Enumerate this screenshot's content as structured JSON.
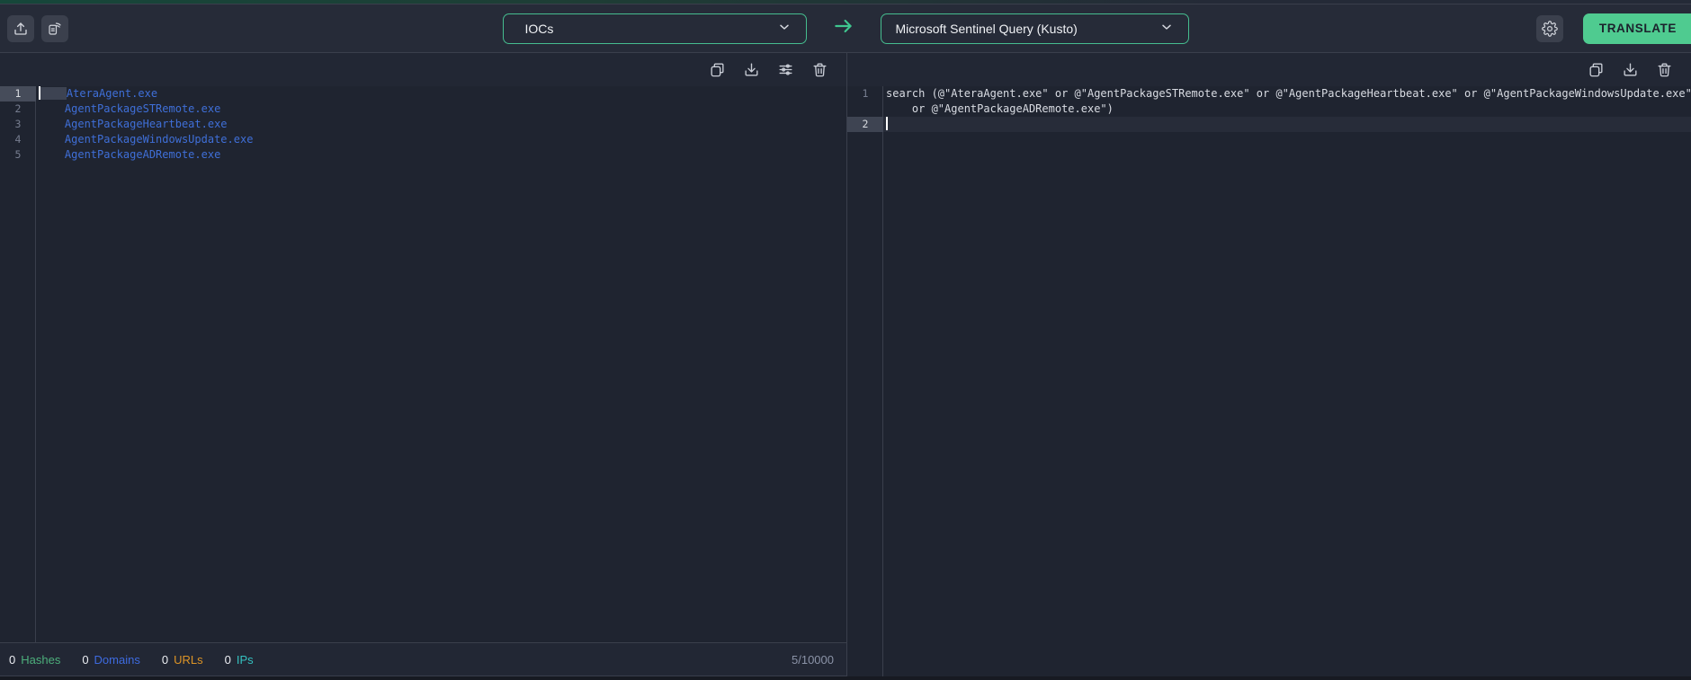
{
  "header": {
    "source_select": {
      "value": "IOCs"
    },
    "target_select": {
      "value": "Microsoft Sentinel Query (Kusto)"
    },
    "translate_label": "TRANSLATE"
  },
  "icons": {
    "upload": "tray-with-up-arrow",
    "bulk-samples": "fanned-document-stack",
    "copy": "two-overlapping-rectangles",
    "download": "tray-with-down-arrow",
    "ioc-settings": "horizontal-sliders",
    "delete": "trash-can",
    "settings": "gear-cog",
    "chevron-down": "⌄",
    "arrow-right": "→"
  },
  "source_editor": {
    "indent": "    ",
    "active_line": 1,
    "lines": [
      "AteraAgent.exe",
      "AgentPackageSTRemote.exe",
      "AgentPackageHeartbeat.exe",
      "AgentPackageWindowsUpdate.exe",
      "AgentPackageADRemote.exe"
    ]
  },
  "target_editor": {
    "active_line": 2,
    "rows": [
      {
        "number": "1",
        "lines": [
          "search (@\"AteraAgent.exe\" or @\"AgentPackageSTRemote.exe\" or @\"AgentPackageHeartbeat.exe\" or @\"AgentPackageWindowsUpdate.exe\"",
          "    or @\"AgentPackageADRemote.exe\")"
        ]
      },
      {
        "number": "2",
        "lines": [
          ""
        ]
      }
    ]
  },
  "status": {
    "counts": [
      {
        "value": "0",
        "label": "Hashes",
        "color": "#4daf7c"
      },
      {
        "value": "0",
        "label": "Domains",
        "color": "#3e6be0"
      },
      {
        "value": "0",
        "label": "URLs",
        "color": "#dd9426"
      },
      {
        "value": "0",
        "label": "IPs",
        "color": "#35c1c0"
      }
    ],
    "limit": "5/10000"
  },
  "colors": {
    "accent_green": "#4fcb90",
    "select_border": "#45bd8f",
    "ioc_blue": "#3f6fd8",
    "editor_bg": "#1f2430",
    "header_bg": "#262b38"
  }
}
